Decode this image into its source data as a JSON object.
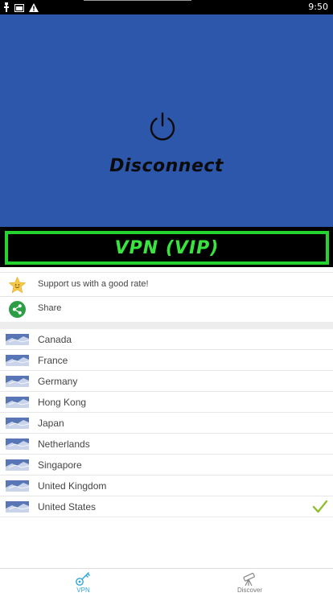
{
  "status_bar": {
    "time": "9:50"
  },
  "hero": {
    "connection_label": "Disconnect"
  },
  "vip_banner": {
    "label": "VPN (VIP)"
  },
  "actions": [
    {
      "label": "Support us with a good rate!",
      "icon": "star-smile-icon"
    },
    {
      "label": "Share",
      "icon": "share-icon"
    }
  ],
  "countries": [
    {
      "name": "Canada",
      "icon": "flag-icon"
    },
    {
      "name": "France",
      "icon": "flag-icon"
    },
    {
      "name": "Germany",
      "icon": "flag-icon"
    },
    {
      "name": "Hong Kong",
      "icon": "flag-icon"
    },
    {
      "name": "Japan",
      "icon": "flag-icon"
    },
    {
      "name": "Netherlands",
      "icon": "flag-icon"
    },
    {
      "name": "Singapore",
      "icon": "flag-icon"
    },
    {
      "name": "United Kingdom",
      "icon": "flag-icon"
    },
    {
      "name": "United States",
      "icon": "flag-icon",
      "selected": true
    }
  ],
  "bottom_nav": {
    "vpn_label": "VPN",
    "discover_label": "Discover"
  },
  "colors": {
    "hero_bg": "#2d57ab",
    "vip_green": "#26d22e",
    "check_green": "#8fbf2f",
    "nav_active": "#2fa3d6"
  }
}
